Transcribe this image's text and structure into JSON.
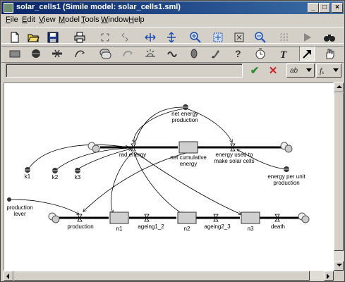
{
  "window": {
    "title": "solar_cells1 (Simile model: solar_cells1.sml)"
  },
  "titlebar_buttons": {
    "minimize": "_",
    "maximize": "□",
    "close": "×"
  },
  "menu": [
    {
      "label": "File",
      "key": "F",
      "rest": "ile"
    },
    {
      "label": "Edit",
      "key": "E",
      "rest": "dit"
    },
    {
      "label": "View",
      "key": "V",
      "rest": "iew"
    },
    {
      "label": "Model",
      "key": "M",
      "rest": "odel"
    },
    {
      "label": "Tools",
      "key": "T",
      "rest": "ools"
    },
    {
      "label": "Window",
      "key": "W",
      "rest": "indow"
    },
    {
      "label": "Help",
      "key": "H",
      "rest": "elp"
    }
  ],
  "toolbar1": [
    "new-file-icon",
    "open-folder-icon",
    "save-icon",
    "print-icon",
    "cut-icon",
    "copy-icon",
    "paste-icon",
    "resize-horizontal-icon",
    "resize-vertical-icon",
    "zoom-in-icon",
    "zoom-fit-icon",
    "zoom-region-icon",
    "zoom-out-icon",
    "grid-icon",
    "run-icon",
    "binoculars-icon"
  ],
  "toolbar2": [
    "compartment-tool-icon",
    "variable-tool-icon",
    "flow-tool-icon",
    "influence-tool-icon",
    "submodel-tool-icon",
    "role-arrow-tool-icon",
    "event-tool-icon",
    "wave-tool-icon",
    "condition-tool-icon",
    "alarm-tool-icon",
    "help-tool-icon",
    "timer-tool-icon",
    "text-tool-icon",
    "pointer-tool-icon",
    "hand-tool-icon"
  ],
  "equation_bar": {
    "value": "",
    "accept": "✔",
    "cancel": "✕",
    "units_label": "ab",
    "function_label": "fₓ"
  },
  "colors": {
    "title_start": "#0a246a",
    "title_end": "#3a6ea5",
    "accept": "#2e8b2e",
    "cancel": "#cc2222"
  },
  "diagram": {
    "labels": {
      "net_energy_production": [
        "net energy",
        "production"
      ],
      "rad_energy": "rad energy",
      "net_cumulative_energy": [
        "net cumulative",
        "energy"
      ],
      "energy_used": [
        "energy used to",
        "make solar cells"
      ],
      "energy_per_unit": [
        "energy per unit",
        "production"
      ],
      "k1": "k1",
      "k2": "k2",
      "k3": "k3",
      "production_lever": [
        "production",
        "lever"
      ],
      "production": "production",
      "n1": "n1",
      "ageing1_2": "ageing1_2",
      "n2": "n2",
      "ageing2_3": "ageing2_3",
      "n3": "n3",
      "death": "death"
    }
  }
}
